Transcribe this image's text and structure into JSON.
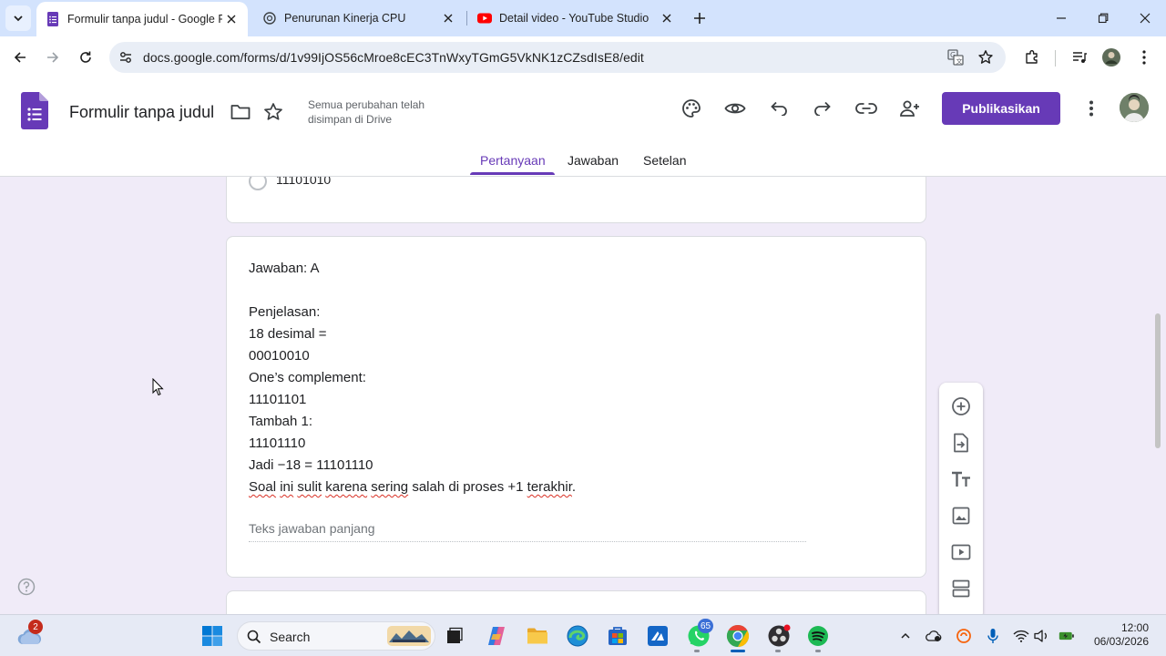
{
  "browser": {
    "tabs": [
      {
        "title": "Formulir tanpa judul - Google Formulir",
        "active": true
      },
      {
        "title": "Penurunan Kinerja CPU",
        "active": false
      },
      {
        "title": "Detail video - YouTube Studio",
        "active": false
      }
    ],
    "url": "docs.google.com/forms/d/1v99IjOS56cMroe8cEC3TnWxyTGmG5VkNK1zCZsdIsE8/edit"
  },
  "forms": {
    "title": "Formulir tanpa judul",
    "save_status": "Semua perubahan telah disimpan di Drive",
    "publish_label": "Publikasikan",
    "tabs": [
      "Pertanyaan",
      "Jawaban",
      "Setelan"
    ],
    "active_tab": "Pertanyaan",
    "accent_color": "#673ab7"
  },
  "content": {
    "prev_option": "11101010",
    "answer_lines": [
      "Jawaban: A",
      "",
      "Penjelasan:",
      "18 desimal =",
      "00010010",
      "One’s complement:",
      "11101101",
      "Tambah 1:",
      "11101110",
      "Jadi −18 = 11101110"
    ],
    "last_line": {
      "w1": "Soal",
      "w2": "ini",
      "w3": "sulit",
      "w4": "karena",
      "w5": "sering",
      "plain": "salah di proses +1",
      "w6": "terakhir",
      "end": "."
    },
    "long_answer_placeholder": "Teks jawaban panjang",
    "side_tools": [
      "add-question-icon",
      "import-questions-icon",
      "add-title-icon",
      "add-image-icon",
      "add-video-icon",
      "add-section-icon"
    ]
  },
  "taskbar": {
    "search_label": "Search",
    "weather_badge": "2",
    "whatsapp_badge": "65",
    "time": "12:00",
    "date": "06/03/2026"
  }
}
